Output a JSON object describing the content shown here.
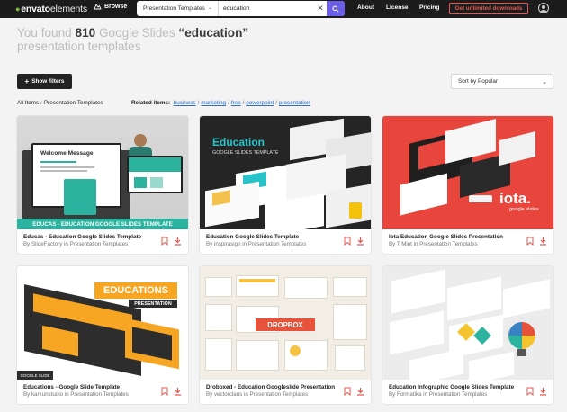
{
  "header": {
    "logo_bold": "envato",
    "logo_light": "elements",
    "browse_label": "Browse",
    "search": {
      "category": "Presentation Templates",
      "query": "education"
    },
    "nav": [
      "About",
      "License",
      "Pricing"
    ],
    "cta_label": "Get unlimited downloads"
  },
  "results": {
    "prefix": "You found ",
    "count": "810",
    "middle": " Google Slides ",
    "query": "“education”",
    "suffix": " presentation templates"
  },
  "toolbar": {
    "filters_label": "Show filters",
    "sort_label": "Sort by Popular"
  },
  "breadcrumb": {
    "items": [
      "All Items",
      "Presentation Templates"
    ]
  },
  "related": {
    "label": "Related items:",
    "links": [
      "business",
      "marketing",
      "free",
      "powerpoint",
      "presentation"
    ]
  },
  "cards": [
    {
      "title": "Educas - Education Google Slides Template",
      "author": "By SlideFactory in Presentation Templates",
      "thumb_text": "Welcome Message",
      "banner": "EDUCAS - EDUCATION GOOGLE SLIDES TEMPLATE",
      "accent": "#2bb3a0"
    },
    {
      "title": "Education Google Slides Template",
      "author": "By inspirasign in Presentation Templates",
      "thumb_text": "Education",
      "thumb_sub": "GOOGLE SLIDES TEMPLATE",
      "accent": "#28c3c9"
    },
    {
      "title": "Iota Education Google Slides Presentation",
      "author": "By T Mint in Presentation Templates",
      "thumb_text": "iota.",
      "thumb_sub": "google slides",
      "accent": "#e8453c"
    },
    {
      "title": "Educations - Google Slide Template",
      "author": "By karkunstudio in Presentation Templates",
      "thumb_text": "EDUCATIONS",
      "thumb_sub": "PRESENTATION",
      "corner": "GOOGLE SLIDE",
      "accent": "#f6a623"
    },
    {
      "title": "Droboxed - Education Googleslide Presentation",
      "author": "By vectorclans in Presentation Templates",
      "thumb_text": "DROPBOX",
      "accent": "#e7523b"
    },
    {
      "title": "Education Infographic Google Slides Template",
      "author": "By Formatika in Presentation Templates",
      "accent": "#f4c430"
    }
  ]
}
